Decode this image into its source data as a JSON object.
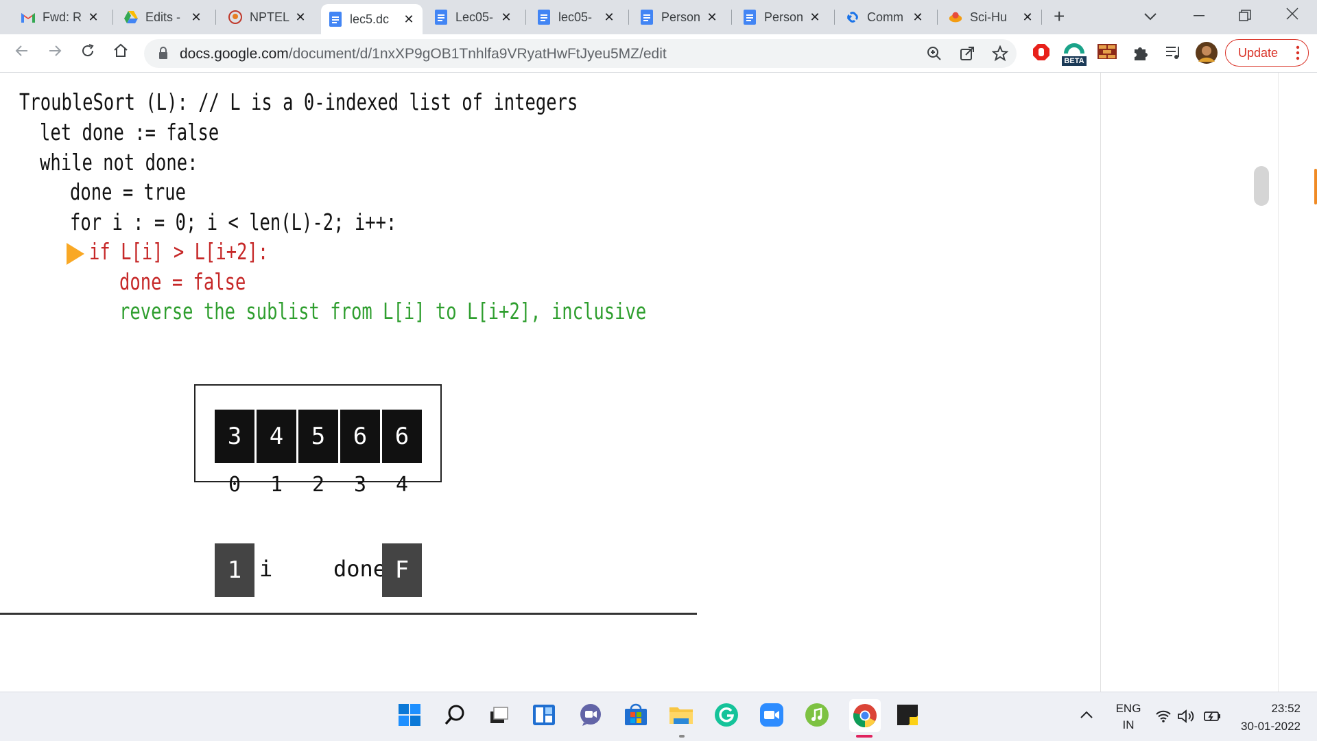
{
  "browser": {
    "tabs": [
      {
        "title": "Fwd: R",
        "icon": "gmail-icon",
        "active": false
      },
      {
        "title": "Edits -",
        "icon": "drive-icon",
        "active": false
      },
      {
        "title": "NPTEL",
        "icon": "nptel-icon",
        "active": false
      },
      {
        "title": "lec5.dc",
        "icon": "docs-icon",
        "active": true
      },
      {
        "title": "Lec05-",
        "icon": "docs-icon",
        "active": false
      },
      {
        "title": "lec05-",
        "icon": "docs-icon",
        "active": false
      },
      {
        "title": "Person",
        "icon": "docs-icon",
        "active": false
      },
      {
        "title": "Person",
        "icon": "docs-icon",
        "active": false
      },
      {
        "title": "Comm",
        "icon": "link-icon",
        "active": false
      },
      {
        "title": "Sci-Hu",
        "icon": "scihub-icon",
        "active": false
      }
    ],
    "new_tab_label": "+",
    "url_domain": "docs.google.com",
    "url_path": "/document/d/1nxXP9gOB1Tnhlfa9VRyatHwFtJyeu5MZ/edit",
    "update_label": "Update",
    "beta_badge": "BETA",
    "colors": {
      "tabstrip": "#dee1e6",
      "update_red": "#d93025"
    }
  },
  "slide": {
    "code_lines": {
      "l1": "TroubleSort (L): // L is a 0-indexed list of integers",
      "l2": "let done := false",
      "l3": "while not done:",
      "l4": "done = true",
      "l5": "for i : = 0; i < len(L)-2; i++:",
      "l6": "if L[i] > L[i+2]:",
      "l7": "done = false",
      "l8": "reverse the sublist from L[i] to L[i+2], inclusive"
    },
    "array_values": [
      "3",
      "4",
      "5",
      "6",
      "6"
    ],
    "array_indices": [
      "0",
      "1",
      "2",
      "3",
      "4"
    ],
    "i_value": "1",
    "i_label": "i",
    "done_label": "done",
    "done_value": "F",
    "colors": {
      "highlight_red": "#c62828",
      "highlight_green": "#2e9e2e",
      "pointer": "#f9a825"
    }
  },
  "taskbar": {
    "lang_top": "ENG",
    "lang_bottom": "IN",
    "time": "23:52",
    "date": "30-01-2022",
    "apps": [
      "windows-start-icon",
      "search-icon",
      "task-view-icon",
      "widgets-icon",
      "teams-chat-icon",
      "store-icon",
      "file-explorer-icon",
      "grammarly-icon",
      "zoom-icon",
      "music-app-icon",
      "chrome-icon",
      "sticky-notes-icon"
    ]
  }
}
